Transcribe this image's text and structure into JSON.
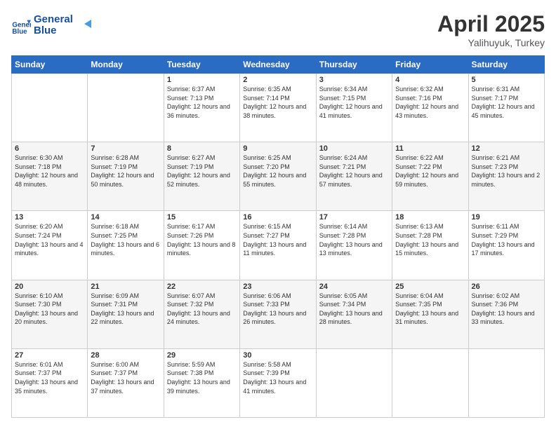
{
  "header": {
    "logo_line1": "General",
    "logo_line2": "Blue",
    "month_title": "April 2025",
    "subtitle": "Yalihuyuk, Turkey"
  },
  "weekdays": [
    "Sunday",
    "Monday",
    "Tuesday",
    "Wednesday",
    "Thursday",
    "Friday",
    "Saturday"
  ],
  "weeks": [
    [
      {
        "day": "",
        "info": ""
      },
      {
        "day": "",
        "info": ""
      },
      {
        "day": "1",
        "info": "Sunrise: 6:37 AM\nSunset: 7:13 PM\nDaylight: 12 hours and 36 minutes."
      },
      {
        "day": "2",
        "info": "Sunrise: 6:35 AM\nSunset: 7:14 PM\nDaylight: 12 hours and 38 minutes."
      },
      {
        "day": "3",
        "info": "Sunrise: 6:34 AM\nSunset: 7:15 PM\nDaylight: 12 hours and 41 minutes."
      },
      {
        "day": "4",
        "info": "Sunrise: 6:32 AM\nSunset: 7:16 PM\nDaylight: 12 hours and 43 minutes."
      },
      {
        "day": "5",
        "info": "Sunrise: 6:31 AM\nSunset: 7:17 PM\nDaylight: 12 hours and 45 minutes."
      }
    ],
    [
      {
        "day": "6",
        "info": "Sunrise: 6:30 AM\nSunset: 7:18 PM\nDaylight: 12 hours and 48 minutes."
      },
      {
        "day": "7",
        "info": "Sunrise: 6:28 AM\nSunset: 7:19 PM\nDaylight: 12 hours and 50 minutes."
      },
      {
        "day": "8",
        "info": "Sunrise: 6:27 AM\nSunset: 7:19 PM\nDaylight: 12 hours and 52 minutes."
      },
      {
        "day": "9",
        "info": "Sunrise: 6:25 AM\nSunset: 7:20 PM\nDaylight: 12 hours and 55 minutes."
      },
      {
        "day": "10",
        "info": "Sunrise: 6:24 AM\nSunset: 7:21 PM\nDaylight: 12 hours and 57 minutes."
      },
      {
        "day": "11",
        "info": "Sunrise: 6:22 AM\nSunset: 7:22 PM\nDaylight: 12 hours and 59 minutes."
      },
      {
        "day": "12",
        "info": "Sunrise: 6:21 AM\nSunset: 7:23 PM\nDaylight: 13 hours and 2 minutes."
      }
    ],
    [
      {
        "day": "13",
        "info": "Sunrise: 6:20 AM\nSunset: 7:24 PM\nDaylight: 13 hours and 4 minutes."
      },
      {
        "day": "14",
        "info": "Sunrise: 6:18 AM\nSunset: 7:25 PM\nDaylight: 13 hours and 6 minutes."
      },
      {
        "day": "15",
        "info": "Sunrise: 6:17 AM\nSunset: 7:26 PM\nDaylight: 13 hours and 8 minutes."
      },
      {
        "day": "16",
        "info": "Sunrise: 6:15 AM\nSunset: 7:27 PM\nDaylight: 13 hours and 11 minutes."
      },
      {
        "day": "17",
        "info": "Sunrise: 6:14 AM\nSunset: 7:28 PM\nDaylight: 13 hours and 13 minutes."
      },
      {
        "day": "18",
        "info": "Sunrise: 6:13 AM\nSunset: 7:28 PM\nDaylight: 13 hours and 15 minutes."
      },
      {
        "day": "19",
        "info": "Sunrise: 6:11 AM\nSunset: 7:29 PM\nDaylight: 13 hours and 17 minutes."
      }
    ],
    [
      {
        "day": "20",
        "info": "Sunrise: 6:10 AM\nSunset: 7:30 PM\nDaylight: 13 hours and 20 minutes."
      },
      {
        "day": "21",
        "info": "Sunrise: 6:09 AM\nSunset: 7:31 PM\nDaylight: 13 hours and 22 minutes."
      },
      {
        "day": "22",
        "info": "Sunrise: 6:07 AM\nSunset: 7:32 PM\nDaylight: 13 hours and 24 minutes."
      },
      {
        "day": "23",
        "info": "Sunrise: 6:06 AM\nSunset: 7:33 PM\nDaylight: 13 hours and 26 minutes."
      },
      {
        "day": "24",
        "info": "Sunrise: 6:05 AM\nSunset: 7:34 PM\nDaylight: 13 hours and 28 minutes."
      },
      {
        "day": "25",
        "info": "Sunrise: 6:04 AM\nSunset: 7:35 PM\nDaylight: 13 hours and 31 minutes."
      },
      {
        "day": "26",
        "info": "Sunrise: 6:02 AM\nSunset: 7:36 PM\nDaylight: 13 hours and 33 minutes."
      }
    ],
    [
      {
        "day": "27",
        "info": "Sunrise: 6:01 AM\nSunset: 7:37 PM\nDaylight: 13 hours and 35 minutes."
      },
      {
        "day": "28",
        "info": "Sunrise: 6:00 AM\nSunset: 7:37 PM\nDaylight: 13 hours and 37 minutes."
      },
      {
        "day": "29",
        "info": "Sunrise: 5:59 AM\nSunset: 7:38 PM\nDaylight: 13 hours and 39 minutes."
      },
      {
        "day": "30",
        "info": "Sunrise: 5:58 AM\nSunset: 7:39 PM\nDaylight: 13 hours and 41 minutes."
      },
      {
        "day": "",
        "info": ""
      },
      {
        "day": "",
        "info": ""
      },
      {
        "day": "",
        "info": ""
      }
    ]
  ]
}
